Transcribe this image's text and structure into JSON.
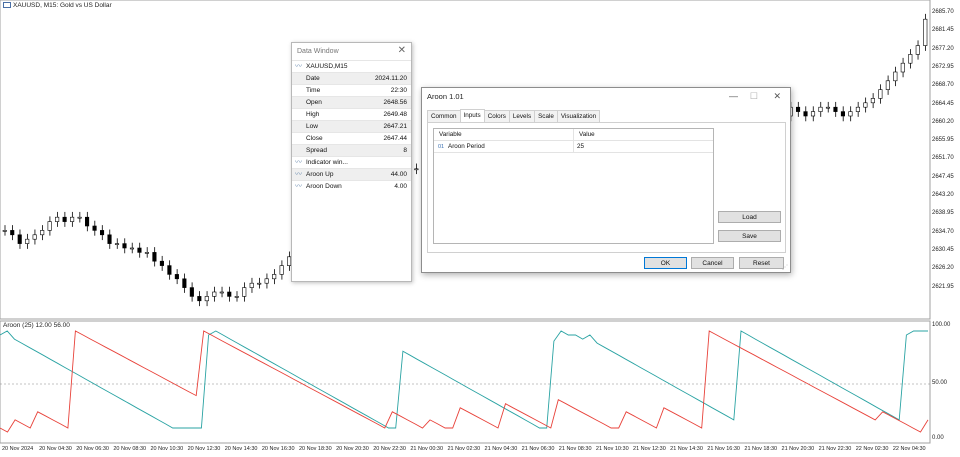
{
  "price_panel": {
    "symbol_caption": "XAUUSD, M15:  Gold vs US Dollar",
    "price_labels": [
      "2685.70",
      "2681.45",
      "2677.20",
      "2672.95",
      "2668.70",
      "2664.45",
      "2660.20",
      "2655.95",
      "2651.70",
      "2647.45",
      "2643.20",
      "2638.95",
      "2634.70",
      "2630.45",
      "2626.20",
      "2621.95"
    ],
    "candles": [
      2638,
      2637,
      2635,
      2636,
      2637,
      2638,
      2640,
      2641,
      2640,
      2641,
      2641,
      2639,
      2638,
      2637,
      2635,
      2635,
      2634,
      2634,
      2633,
      2633,
      2631,
      2630,
      2628,
      2627,
      2625,
      2623,
      2622,
      2623,
      2624,
      2624,
      2623,
      2623,
      2625,
      2626,
      2626,
      2627,
      2628,
      2630,
      2632,
      2634,
      2636,
      2637,
      2640,
      2643,
      2645,
      2646,
      2647,
      2648,
      2648,
      2649,
      2650,
      2651,
      2651,
      2652,
      2652,
      2652,
      2653,
      2652,
      2651,
      2650,
      2652,
      2651,
      2650,
      2652,
      2653,
      2651,
      2650,
      2652,
      2654,
      2655,
      2654,
      2653,
      2654,
      2656,
      2657,
      2659,
      2661,
      2662,
      2665,
      2664,
      2663,
      2661,
      2660,
      2659,
      2658,
      2660,
      2662,
      2663,
      2661,
      2660,
      2659,
      2661,
      2662,
      2663,
      2665,
      2666,
      2665,
      2667,
      2668,
      2667,
      2666,
      2664,
      2663,
      2662,
      2664,
      2666,
      2665,
      2664,
      2665,
      2666,
      2666,
      2665,
      2664,
      2665,
      2666,
      2667,
      2668,
      2670,
      2672,
      2674,
      2676,
      2678,
      2680,
      2686
    ]
  },
  "indicator_panel": {
    "caption": "Aroon (25) 12.00 56.00",
    "scale_labels": [
      "100.00",
      "50.00",
      "0.00"
    ],
    "aroon_up": [
      96,
      100,
      92,
      88,
      84,
      80,
      76,
      72,
      68,
      64,
      60,
      56,
      52,
      48,
      44,
      40,
      36,
      32,
      28,
      24,
      20,
      16,
      12,
      8,
      4,
      4,
      4,
      4,
      4,
      96,
      100,
      96,
      92,
      88,
      84,
      80,
      76,
      72,
      68,
      64,
      60,
      56,
      52,
      48,
      44,
      40,
      36,
      32,
      28,
      24,
      20,
      16,
      12,
      8,
      4,
      4,
      80,
      76,
      72,
      68,
      64,
      60,
      56,
      52,
      48,
      44,
      40,
      36,
      32,
      28,
      24,
      20,
      16,
      12,
      8,
      4,
      4,
      90,
      100,
      96,
      96,
      92,
      96,
      88,
      84,
      80,
      76,
      72,
      68,
      64,
      60,
      56,
      52,
      48,
      44,
      40,
      36,
      32,
      28,
      24,
      20,
      16,
      12,
      100,
      96,
      92,
      88,
      84,
      80,
      76,
      72,
      68,
      64,
      60,
      56,
      52,
      48,
      44,
      40,
      36,
      32,
      28,
      24,
      20,
      16,
      12,
      96,
      100,
      100,
      100
    ],
    "aroon_down": [
      4,
      0,
      12,
      8,
      4,
      20,
      16,
      12,
      8,
      4,
      100,
      96,
      92,
      88,
      84,
      80,
      76,
      72,
      68,
      64,
      60,
      56,
      52,
      48,
      44,
      40,
      36,
      100,
      96,
      92,
      88,
      84,
      80,
      76,
      72,
      68,
      64,
      60,
      56,
      52,
      48,
      44,
      40,
      36,
      32,
      28,
      24,
      20,
      16,
      12,
      8,
      4,
      20,
      16,
      12,
      8,
      4,
      12,
      8,
      4,
      4,
      24,
      20,
      16,
      12,
      8,
      4,
      28,
      24,
      20,
      16,
      12,
      8,
      4,
      32,
      28,
      24,
      20,
      16,
      12,
      8,
      4,
      4,
      20,
      16,
      12,
      8,
      4,
      24,
      20,
      16,
      12,
      8,
      4,
      100,
      96,
      92,
      88,
      84,
      80,
      76,
      72,
      68,
      64,
      60,
      56,
      52,
      48,
      44,
      40,
      36,
      32,
      28,
      24,
      20,
      16,
      12,
      20,
      16,
      12,
      8,
      4,
      0,
      12
    ]
  },
  "time_axis": {
    "labels": [
      "20 Nov 2024",
      "20 Nov 04:30",
      "20 Nov 06:30",
      "20 Nov 08:30",
      "20 Nov 10:30",
      "20 Nov 12:30",
      "20 Nov 14:30",
      "20 Nov 16:30",
      "20 Nov 18:30",
      "20 Nov 20:30",
      "20 Nov 22:30",
      "21 Nov 00:30",
      "21 Nov 02:30",
      "21 Nov 04:30",
      "21 Nov 06:30",
      "21 Nov 08:30",
      "21 Nov 10:30",
      "21 Nov 12:30",
      "21 Nov 14:30",
      "21 Nov 16:30",
      "21 Nov 18:30",
      "21 Nov 20:30",
      "21 Nov 22:30",
      "22 Nov 02:30",
      "22 Nov 04:30"
    ]
  },
  "data_window": {
    "title": "Data Window",
    "symbol": "XAUUSD,M15",
    "rows": [
      {
        "k": "Date",
        "v": "2024.11.20"
      },
      {
        "k": "Time",
        "v": "22:30"
      },
      {
        "k": "Open",
        "v": "2648.56"
      },
      {
        "k": "High",
        "v": "2649.48"
      },
      {
        "k": "Low",
        "v": "2647.21"
      },
      {
        "k": "Close",
        "v": "2647.44"
      },
      {
        "k": "Spread",
        "v": "8"
      }
    ],
    "indicator_header": "Indicator win...",
    "indicator_rows": [
      {
        "k": "Aroon Up",
        "v": "44.00"
      },
      {
        "k": "Aroon Down",
        "v": "4.00"
      }
    ]
  },
  "dialog": {
    "title": "Aroon 1.01",
    "tabs": [
      "Common",
      "Inputs",
      "Colors",
      "Levels",
      "Scale",
      "Visualization"
    ],
    "grid_headers": [
      "Variable",
      "Value"
    ],
    "param_icon": "01",
    "param_name": "Aroon Period",
    "param_value": "25",
    "load_label": "Load",
    "save_label": "Save",
    "ok_label": "OK",
    "cancel_label": "Cancel",
    "reset_label": "Reset"
  },
  "colors": {
    "aroon_up": "#2aa3a3",
    "aroon_down": "#e8423a",
    "focus_border": "#0078d7"
  }
}
